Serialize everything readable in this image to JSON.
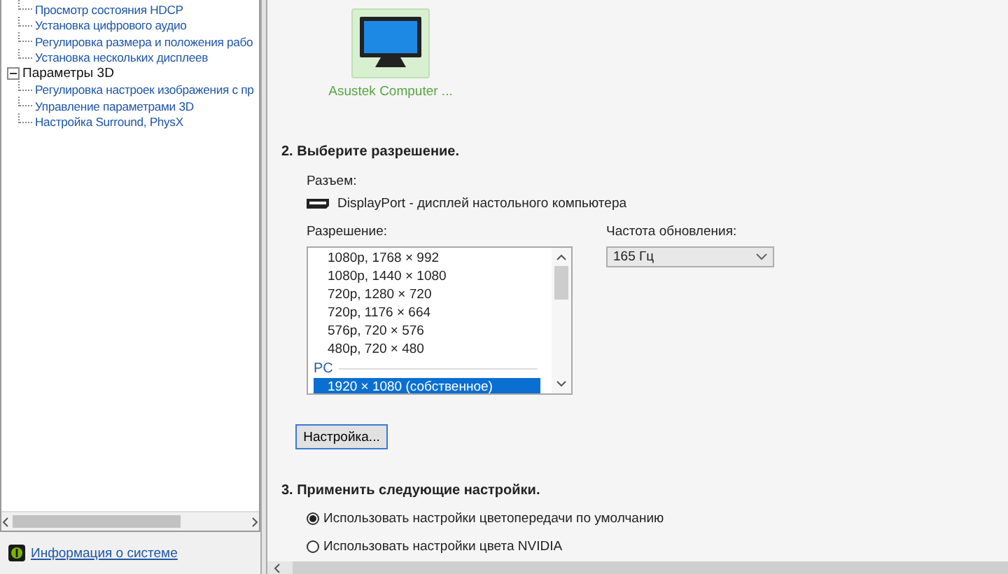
{
  "tree": [
    {
      "children": [
        {
          "label": "Просмотр состояния HDCP"
        },
        {
          "label": "Установка цифрового аудио"
        },
        {
          "label": "Регулировка размера и положения рабо"
        },
        {
          "label": "Установка нескольких дисплеев"
        }
      ]
    },
    {
      "label": "Параметры 3D",
      "expanded": true,
      "children": [
        {
          "label": "Регулировка настроек изображения с пр"
        },
        {
          "label": "Управление параметрами 3D"
        },
        {
          "label": "Настройка Surround, PhysX"
        }
      ]
    }
  ],
  "system_info_link": "Информация о системе",
  "display": {
    "name": "Asustek Computer ...",
    "selected": true
  },
  "section_2": {
    "title": "2. Выберите разрешение.",
    "connector_label": "Разъем:",
    "connector": "DisplayPort - дисплей настольного компьютера",
    "resolution_label": "Разрешение:",
    "refresh_label": "Частота обновления:",
    "refresh_value": "165 Гц",
    "resolutions": [
      {
        "kind": "item",
        "label": "1080p, 1768 × 992",
        "selected": false
      },
      {
        "kind": "item",
        "label": "1080p, 1440 × 1080",
        "selected": false
      },
      {
        "kind": "item",
        "label": "720p, 1280 × 720",
        "selected": false
      },
      {
        "kind": "item",
        "label": "720p, 1176 × 664",
        "selected": false
      },
      {
        "kind": "item",
        "label": "576p, 720 × 576",
        "selected": false
      },
      {
        "kind": "item",
        "label": "480p, 720 × 480",
        "selected": false
      },
      {
        "kind": "group",
        "label": "PC"
      },
      {
        "kind": "item",
        "label": "1920 × 1080 (собственное)",
        "selected": true
      }
    ],
    "customize_button": "Настройка..."
  },
  "section_3": {
    "title": "3. Применить следующие настройки.",
    "options": [
      {
        "label": "Использовать настройки цветопередачи по умолчанию",
        "selected": true
      },
      {
        "label": "Использовать настройки цвета NVIDIA",
        "selected": false
      }
    ]
  }
}
